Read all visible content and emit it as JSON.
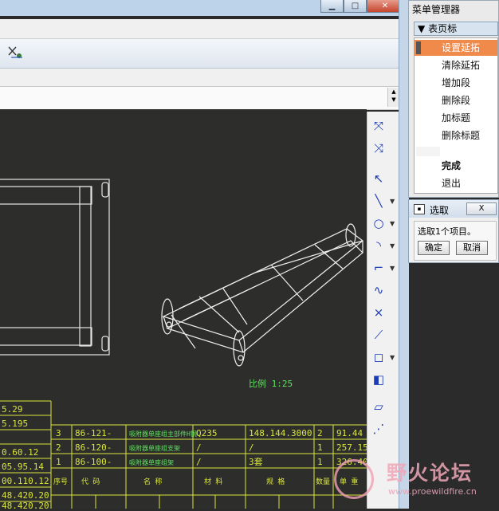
{
  "window": {
    "min_label": "▁",
    "max_label": "□",
    "close_label": "✕"
  },
  "menu_manager": {
    "title": "菜单管理器",
    "header": "表页标",
    "header_arrow": "▼",
    "items": [
      {
        "label": "设置延拓",
        "selected": true
      },
      {
        "label": "清除延拓"
      },
      {
        "label": "增加段"
      },
      {
        "label": "删除段"
      },
      {
        "label": "加标题"
      },
      {
        "label": "删除标题"
      }
    ],
    "done": "完成",
    "quit": "退出"
  },
  "select_dialog": {
    "title": "选取",
    "close": "X",
    "message": "选取1个项目。",
    "ok": "确定",
    "cancel": "取消"
  },
  "palette": {
    "tools": [
      {
        "icon": "dimension-icon",
        "glyph": "⤧",
        "dropdown": false
      },
      {
        "icon": "note-icon",
        "glyph": "⤨",
        "dropdown": false
      },
      {
        "icon": "select-arrow-icon",
        "glyph": "↖",
        "dropdown": false
      },
      {
        "icon": "line-icon",
        "glyph": "╲",
        "dropdown": true
      },
      {
        "icon": "circle-icon",
        "glyph": "○",
        "dropdown": true
      },
      {
        "icon": "arc-icon",
        "glyph": "◝",
        "dropdown": true
      },
      {
        "icon": "fillet-icon",
        "glyph": "⌐",
        "dropdown": true
      },
      {
        "icon": "spline-icon",
        "glyph": "∿",
        "dropdown": false
      },
      {
        "icon": "point-icon",
        "glyph": "×",
        "dropdown": false
      },
      {
        "icon": "chamfer-icon",
        "glyph": "⟋",
        "dropdown": false
      },
      {
        "icon": "offset-icon",
        "glyph": "◻",
        "dropdown": true
      },
      {
        "icon": "mirror-icon",
        "glyph": "◧",
        "dropdown": false
      },
      {
        "icon": "parallelogram-icon",
        "glyph": "▱",
        "dropdown": false
      },
      {
        "icon": "construction-line-icon",
        "glyph": "⋰",
        "dropdown": false
      }
    ]
  },
  "drawing": {
    "scale_label": "比例 1:25",
    "left_numbers": [
      "5.29",
      "5.195",
      "0.60.12",
      "05.95.14",
      "00.110.12",
      "48.420.20",
      "48.420.20"
    ],
    "bom_rows": [
      {
        "no": "3",
        "code": "86-121-",
        "name": "吸附器单座组主部件H钢",
        "material": "Q235",
        "spec": "148.144.3000",
        "qty": "2",
        "weight": "91.44"
      },
      {
        "no": "2",
        "code": "86-120-",
        "name": "吸附器单座组支架",
        "material": "/",
        "spec": "/",
        "qty": "1",
        "weight": "257.15"
      },
      {
        "no": "1",
        "code": "86-100-",
        "name": "吸附器单座组架",
        "material": "/",
        "spec": "3套",
        "qty": "1",
        "weight": "326.40"
      }
    ],
    "bom_header": {
      "no": "序号",
      "code": "代 码",
      "name": "名 称",
      "material": "材 料",
      "spec": "规 格",
      "qty": "数量",
      "weight": "单 重"
    }
  },
  "watermark": {
    "name": "野火论坛",
    "url": "www.proewildfire.cn"
  }
}
